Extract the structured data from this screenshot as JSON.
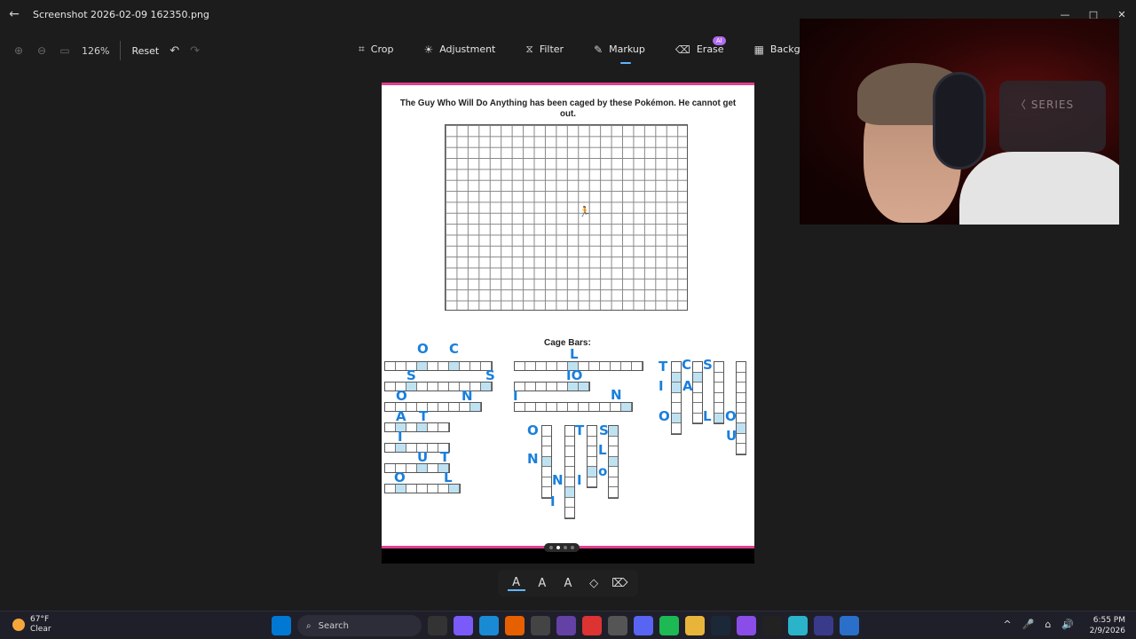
{
  "window": {
    "title": "Screenshot 2026-02-09 162350.png",
    "back_icon": "←",
    "min_icon": "—",
    "max_icon": "□",
    "close_icon": "✕"
  },
  "zoom": {
    "zoom_in_icon": "⊕",
    "zoom_out_icon": "⊖",
    "fit_icon": "▭",
    "value": "126%",
    "reset_label": "Reset",
    "undo_icon": "↶",
    "redo_icon": "↷"
  },
  "tools": {
    "crop": {
      "label": "Crop",
      "icon": "⌗"
    },
    "adjustment": {
      "label": "Adjustment",
      "icon": "☀"
    },
    "filter": {
      "label": "Filter",
      "icon": "⧖"
    },
    "markup": {
      "label": "Markup",
      "icon": "✎"
    },
    "erase": {
      "label": "Erase",
      "icon": "⌫",
      "badge": "AI"
    },
    "background": {
      "label": "Background",
      "icon": "▦"
    }
  },
  "document": {
    "title": "The Guy Who Will Do Anything has been caged by these Pokémon. He cannot get out.",
    "cage_bars_label": "Cage Bars:",
    "guy_icon": "🏃",
    "handwriting": {
      "h1": "O",
      "h2": "C",
      "h3": "S",
      "h4": "S",
      "h5": "O",
      "h6": "N",
      "h7": "A",
      "h8": "T",
      "h9": "I",
      "h10": "U",
      "h11": "T",
      "h12": "O",
      "h13": "L",
      "h14": "L",
      "h15": "IO",
      "h16": "I",
      "h17": "N",
      "h18": "O",
      "h19": "T",
      "h20": "S",
      "h21": "L",
      "h22": "N",
      "h23": "N",
      "h24": "I",
      "h25": "o",
      "h26": "I",
      "h27": "T",
      "h28": "C",
      "h29": "S",
      "h30": "I",
      "h31": "A",
      "h32": "O",
      "h33": "L",
      "h34": "O",
      "h35": "U"
    }
  },
  "markup_tools": [
    "A",
    "A",
    "A",
    "◇",
    "⌦"
  ],
  "webcam": {
    "chair_logo": "〈 SERIES"
  },
  "taskbar": {
    "temp": "67°F",
    "condition": "Clear",
    "search_placeholder": "Search",
    "search_icon": "⌕",
    "time": "6:55 PM",
    "date": "2/9/2026",
    "tray_icons": [
      "^",
      "🎤",
      "⌂",
      "🔊"
    ]
  }
}
